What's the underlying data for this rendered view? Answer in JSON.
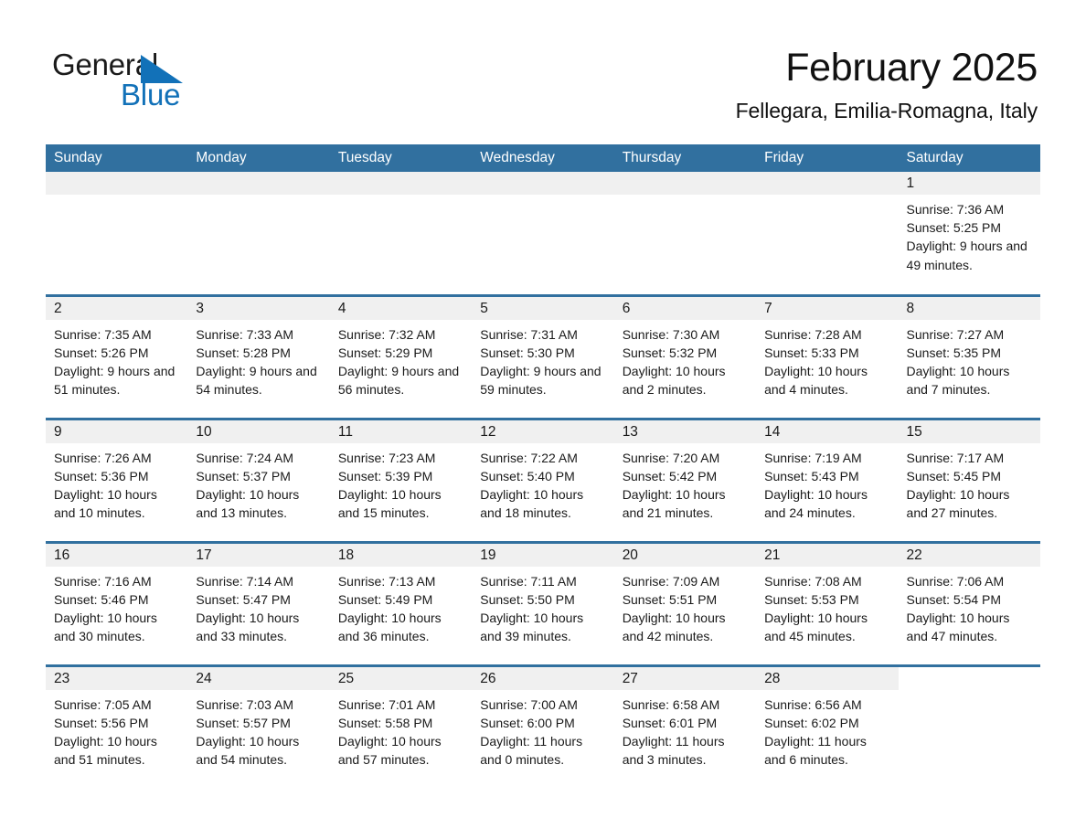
{
  "brand": {
    "name_part1": "General",
    "name_part2": "Blue",
    "triangle_color": "#1271b8",
    "text_color": "#1a1a1a"
  },
  "header": {
    "title": "February 2025",
    "subtitle": "Fellegara, Emilia-Romagna, Italy"
  },
  "theme": {
    "header_blue": "#31709f",
    "date_band_gray": "#f0f0f0",
    "text": "#1a1a1a"
  },
  "weekdays": [
    "Sunday",
    "Monday",
    "Tuesday",
    "Wednesday",
    "Thursday",
    "Friday",
    "Saturday"
  ],
  "labels": {
    "sunrise_prefix": "Sunrise:",
    "sunset_prefix": "Sunset:",
    "daylight_prefix": "Daylight:"
  },
  "weeks": [
    [
      {
        "day": "",
        "blank": true
      },
      {
        "day": "",
        "blank": true
      },
      {
        "day": "",
        "blank": true
      },
      {
        "day": "",
        "blank": true
      },
      {
        "day": "",
        "blank": true
      },
      {
        "day": "",
        "blank": true
      },
      {
        "day": "1",
        "sunrise": "Sunrise: 7:36 AM",
        "sunset": "Sunset: 5:25 PM",
        "daylight": "Daylight: 9 hours and 49 minutes."
      }
    ],
    [
      {
        "day": "2",
        "sunrise": "Sunrise: 7:35 AM",
        "sunset": "Sunset: 5:26 PM",
        "daylight": "Daylight: 9 hours and 51 minutes."
      },
      {
        "day": "3",
        "sunrise": "Sunrise: 7:33 AM",
        "sunset": "Sunset: 5:28 PM",
        "daylight": "Daylight: 9 hours and 54 minutes."
      },
      {
        "day": "4",
        "sunrise": "Sunrise: 7:32 AM",
        "sunset": "Sunset: 5:29 PM",
        "daylight": "Daylight: 9 hours and 56 minutes."
      },
      {
        "day": "5",
        "sunrise": "Sunrise: 7:31 AM",
        "sunset": "Sunset: 5:30 PM",
        "daylight": "Daylight: 9 hours and 59 minutes."
      },
      {
        "day": "6",
        "sunrise": "Sunrise: 7:30 AM",
        "sunset": "Sunset: 5:32 PM",
        "daylight": "Daylight: 10 hours and 2 minutes."
      },
      {
        "day": "7",
        "sunrise": "Sunrise: 7:28 AM",
        "sunset": "Sunset: 5:33 PM",
        "daylight": "Daylight: 10 hours and 4 minutes."
      },
      {
        "day": "8",
        "sunrise": "Sunrise: 7:27 AM",
        "sunset": "Sunset: 5:35 PM",
        "daylight": "Daylight: 10 hours and 7 minutes."
      }
    ],
    [
      {
        "day": "9",
        "sunrise": "Sunrise: 7:26 AM",
        "sunset": "Sunset: 5:36 PM",
        "daylight": "Daylight: 10 hours and 10 minutes."
      },
      {
        "day": "10",
        "sunrise": "Sunrise: 7:24 AM",
        "sunset": "Sunset: 5:37 PM",
        "daylight": "Daylight: 10 hours and 13 minutes."
      },
      {
        "day": "11",
        "sunrise": "Sunrise: 7:23 AM",
        "sunset": "Sunset: 5:39 PM",
        "daylight": "Daylight: 10 hours and 15 minutes."
      },
      {
        "day": "12",
        "sunrise": "Sunrise: 7:22 AM",
        "sunset": "Sunset: 5:40 PM",
        "daylight": "Daylight: 10 hours and 18 minutes."
      },
      {
        "day": "13",
        "sunrise": "Sunrise: 7:20 AM",
        "sunset": "Sunset: 5:42 PM",
        "daylight": "Daylight: 10 hours and 21 minutes."
      },
      {
        "day": "14",
        "sunrise": "Sunrise: 7:19 AM",
        "sunset": "Sunset: 5:43 PM",
        "daylight": "Daylight: 10 hours and 24 minutes."
      },
      {
        "day": "15",
        "sunrise": "Sunrise: 7:17 AM",
        "sunset": "Sunset: 5:45 PM",
        "daylight": "Daylight: 10 hours and 27 minutes."
      }
    ],
    [
      {
        "day": "16",
        "sunrise": "Sunrise: 7:16 AM",
        "sunset": "Sunset: 5:46 PM",
        "daylight": "Daylight: 10 hours and 30 minutes."
      },
      {
        "day": "17",
        "sunrise": "Sunrise: 7:14 AM",
        "sunset": "Sunset: 5:47 PM",
        "daylight": "Daylight: 10 hours and 33 minutes."
      },
      {
        "day": "18",
        "sunrise": "Sunrise: 7:13 AM",
        "sunset": "Sunset: 5:49 PM",
        "daylight": "Daylight: 10 hours and 36 minutes."
      },
      {
        "day": "19",
        "sunrise": "Sunrise: 7:11 AM",
        "sunset": "Sunset: 5:50 PM",
        "daylight": "Daylight: 10 hours and 39 minutes."
      },
      {
        "day": "20",
        "sunrise": "Sunrise: 7:09 AM",
        "sunset": "Sunset: 5:51 PM",
        "daylight": "Daylight: 10 hours and 42 minutes."
      },
      {
        "day": "21",
        "sunrise": "Sunrise: 7:08 AM",
        "sunset": "Sunset: 5:53 PM",
        "daylight": "Daylight: 10 hours and 45 minutes."
      },
      {
        "day": "22",
        "sunrise": "Sunrise: 7:06 AM",
        "sunset": "Sunset: 5:54 PM",
        "daylight": "Daylight: 10 hours and 47 minutes."
      }
    ],
    [
      {
        "day": "23",
        "sunrise": "Sunrise: 7:05 AM",
        "sunset": "Sunset: 5:56 PM",
        "daylight": "Daylight: 10 hours and 51 minutes."
      },
      {
        "day": "24",
        "sunrise": "Sunrise: 7:03 AM",
        "sunset": "Sunset: 5:57 PM",
        "daylight": "Daylight: 10 hours and 54 minutes."
      },
      {
        "day": "25",
        "sunrise": "Sunrise: 7:01 AM",
        "sunset": "Sunset: 5:58 PM",
        "daylight": "Daylight: 10 hours and 57 minutes."
      },
      {
        "day": "26",
        "sunrise": "Sunrise: 7:00 AM",
        "sunset": "Sunset: 6:00 PM",
        "daylight": "Daylight: 11 hours and 0 minutes."
      },
      {
        "day": "27",
        "sunrise": "Sunrise: 6:58 AM",
        "sunset": "Sunset: 6:01 PM",
        "daylight": "Daylight: 11 hours and 3 minutes."
      },
      {
        "day": "28",
        "sunrise": "Sunrise: 6:56 AM",
        "sunset": "Sunset: 6:02 PM",
        "daylight": "Daylight: 11 hours and 6 minutes."
      },
      {
        "day": "",
        "blank": true
      }
    ]
  ]
}
